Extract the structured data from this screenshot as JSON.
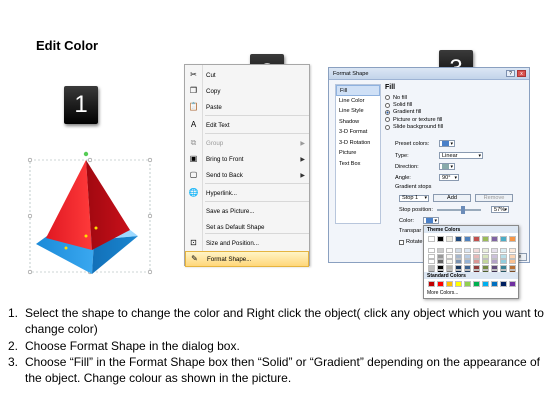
{
  "page_title": "Edit Color",
  "badges": [
    "1",
    "2",
    "3"
  ],
  "context_menu": {
    "items": [
      {
        "label": "Cut",
        "icon": "scissors-icon",
        "glyph": "✂",
        "disabled": false,
        "submenu": false
      },
      {
        "label": "Copy",
        "icon": "copy-icon",
        "glyph": "❐",
        "disabled": false,
        "submenu": false
      },
      {
        "label": "Paste",
        "icon": "paste-icon",
        "glyph": "📋",
        "disabled": false,
        "submenu": false
      },
      {
        "label": "Edit Text",
        "icon": "edit-text-icon",
        "glyph": "A",
        "disabled": false,
        "submenu": false
      },
      {
        "label": "Group",
        "icon": "group-icon",
        "glyph": "⧉",
        "disabled": true,
        "submenu": true
      },
      {
        "label": "Bring to Front",
        "icon": "bring-front-icon",
        "glyph": "▣",
        "disabled": false,
        "submenu": true
      },
      {
        "label": "Send to Back",
        "icon": "send-back-icon",
        "glyph": "▢",
        "disabled": false,
        "submenu": true
      },
      {
        "label": "Hyperlink...",
        "icon": "hyperlink-icon",
        "glyph": "🌐",
        "disabled": false,
        "submenu": false
      },
      {
        "label": "Save as Picture...",
        "icon": "",
        "glyph": "",
        "disabled": false,
        "submenu": false
      },
      {
        "label": "Set as Default Shape",
        "icon": "",
        "glyph": "",
        "disabled": false,
        "submenu": false
      },
      {
        "label": "Size and Position...",
        "icon": "size-position-icon",
        "glyph": "⊡",
        "disabled": false,
        "submenu": false
      },
      {
        "label": "Format Shape...",
        "icon": "format-shape-icon",
        "glyph": "✎",
        "disabled": false,
        "submenu": false
      }
    ]
  },
  "dialog": {
    "title": "Format Shape",
    "window_buttons": {
      "help": "?",
      "close": "x"
    },
    "sidebar": [
      "Fill",
      "Line Color",
      "Line Style",
      "Shadow",
      "3-D Format",
      "3-D Rotation",
      "Picture",
      "Text Box"
    ],
    "section_title": "Fill",
    "fill_options": [
      "No fill",
      "Solid fill",
      "Gradient fill",
      "Picture or texture fill",
      "Slide background fill"
    ],
    "selected_fill": "Gradient fill",
    "preset_colors_label": "Preset colors:",
    "type_label": "Type:",
    "type_value": "Linear",
    "direction_label": "Direction:",
    "angle_label": "Angle:",
    "angle_value": "90°",
    "gradient_stops_label": "Gradient stops",
    "stop_value": "Stop 1",
    "add_button": "Add",
    "remove_button": "Remove",
    "stop_position_label": "Stop position:",
    "stop_position_value": "57%",
    "color_label": "Color:",
    "transparency_label": "Transpar",
    "rotate_label": "Rotate",
    "close_button": "Close"
  },
  "palette": {
    "theme_label": "Theme Colors",
    "standard_label": "Standard Colors",
    "more_label": "More Colors...",
    "theme_top": [
      "#ffffff",
      "#000000",
      "#eeece1",
      "#1f497d",
      "#4f81bd",
      "#c0504d",
      "#9bbb59",
      "#8064a2",
      "#4bacc6",
      "#f79646"
    ],
    "standard": [
      "#c00000",
      "#ff0000",
      "#ffc000",
      "#ffff00",
      "#92d050",
      "#00b050",
      "#00b0f0",
      "#0070c0",
      "#002060",
      "#7030a0"
    ]
  },
  "instructions": [
    {
      "num": "1.",
      "text": "Select the shape to change the color and Right click the object( click any object which you want to change color)"
    },
    {
      "num": "2.",
      "text": "Choose Format Shape in the dialog box."
    },
    {
      "num": "3.",
      "text": "Choose “Fill” in the Format Shape box then “Solid” or “Gradient” depending on the appearance of the object. Change colour as shown in the picture."
    }
  ]
}
